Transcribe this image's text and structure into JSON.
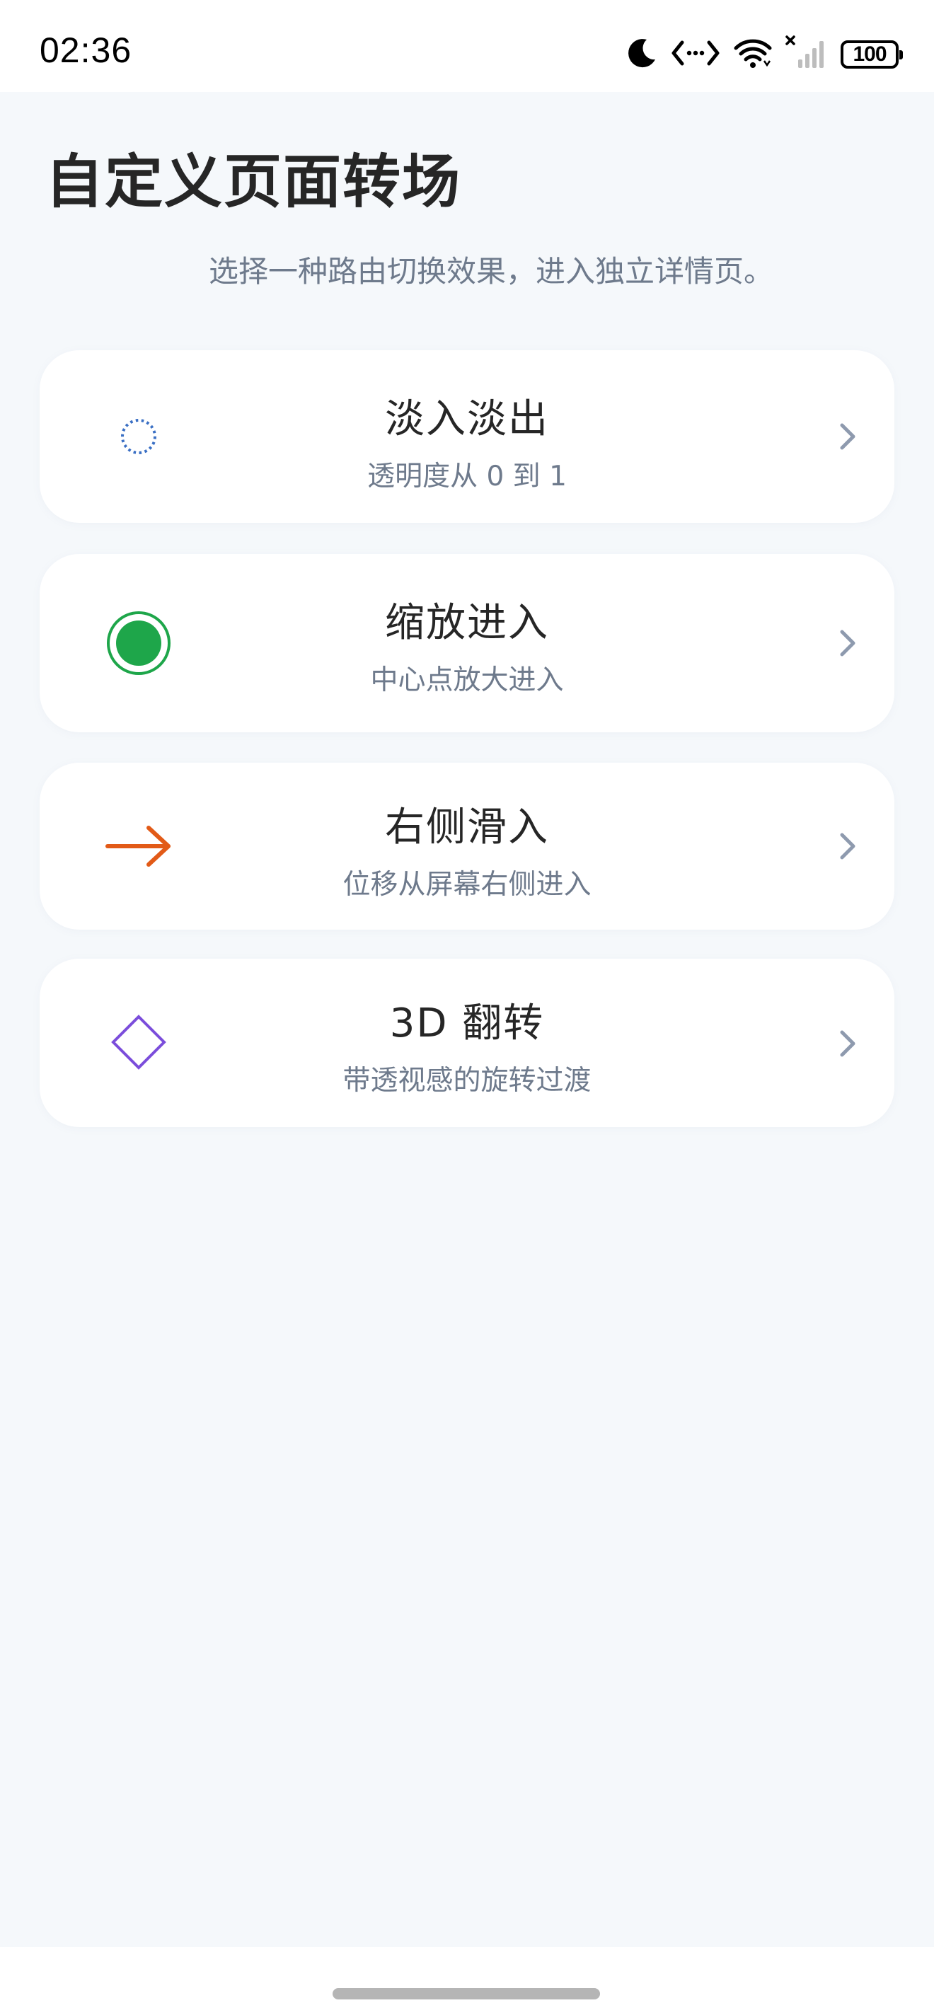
{
  "status_bar": {
    "time": "02:36",
    "battery": "100",
    "icons": [
      "moon-icon",
      "code-brackets-icon",
      "wifi-icon",
      "signal-no-sim-icon",
      "battery-icon"
    ]
  },
  "page": {
    "title": "自定义页面转场",
    "subtitle": "选择一种路由切换效果，进入独立详情页。"
  },
  "cards": [
    {
      "title": "淡入淡出",
      "desc": "透明度从 0 到 1",
      "icon": "dotted-circle-icon",
      "color": "#3a6fc4"
    },
    {
      "title": "缩放进入",
      "desc": "中心点放大进入",
      "icon": "radio-dot-icon",
      "color": "#1ea64a"
    },
    {
      "title": "右侧滑入",
      "desc": "位移从屏幕右侧进入",
      "icon": "arrow-right-icon",
      "color": "#e25a17"
    },
    {
      "title": "3D 翻转",
      "desc": "带透视感的旋转过渡",
      "icon": "diamond-icon",
      "color": "#7b4ddb"
    }
  ],
  "colors": {
    "background": "#f5f8fb",
    "card": "#ffffff",
    "title_text": "#262626",
    "secondary_text": "#6e7a8c",
    "chevron": "#8e9aae"
  }
}
